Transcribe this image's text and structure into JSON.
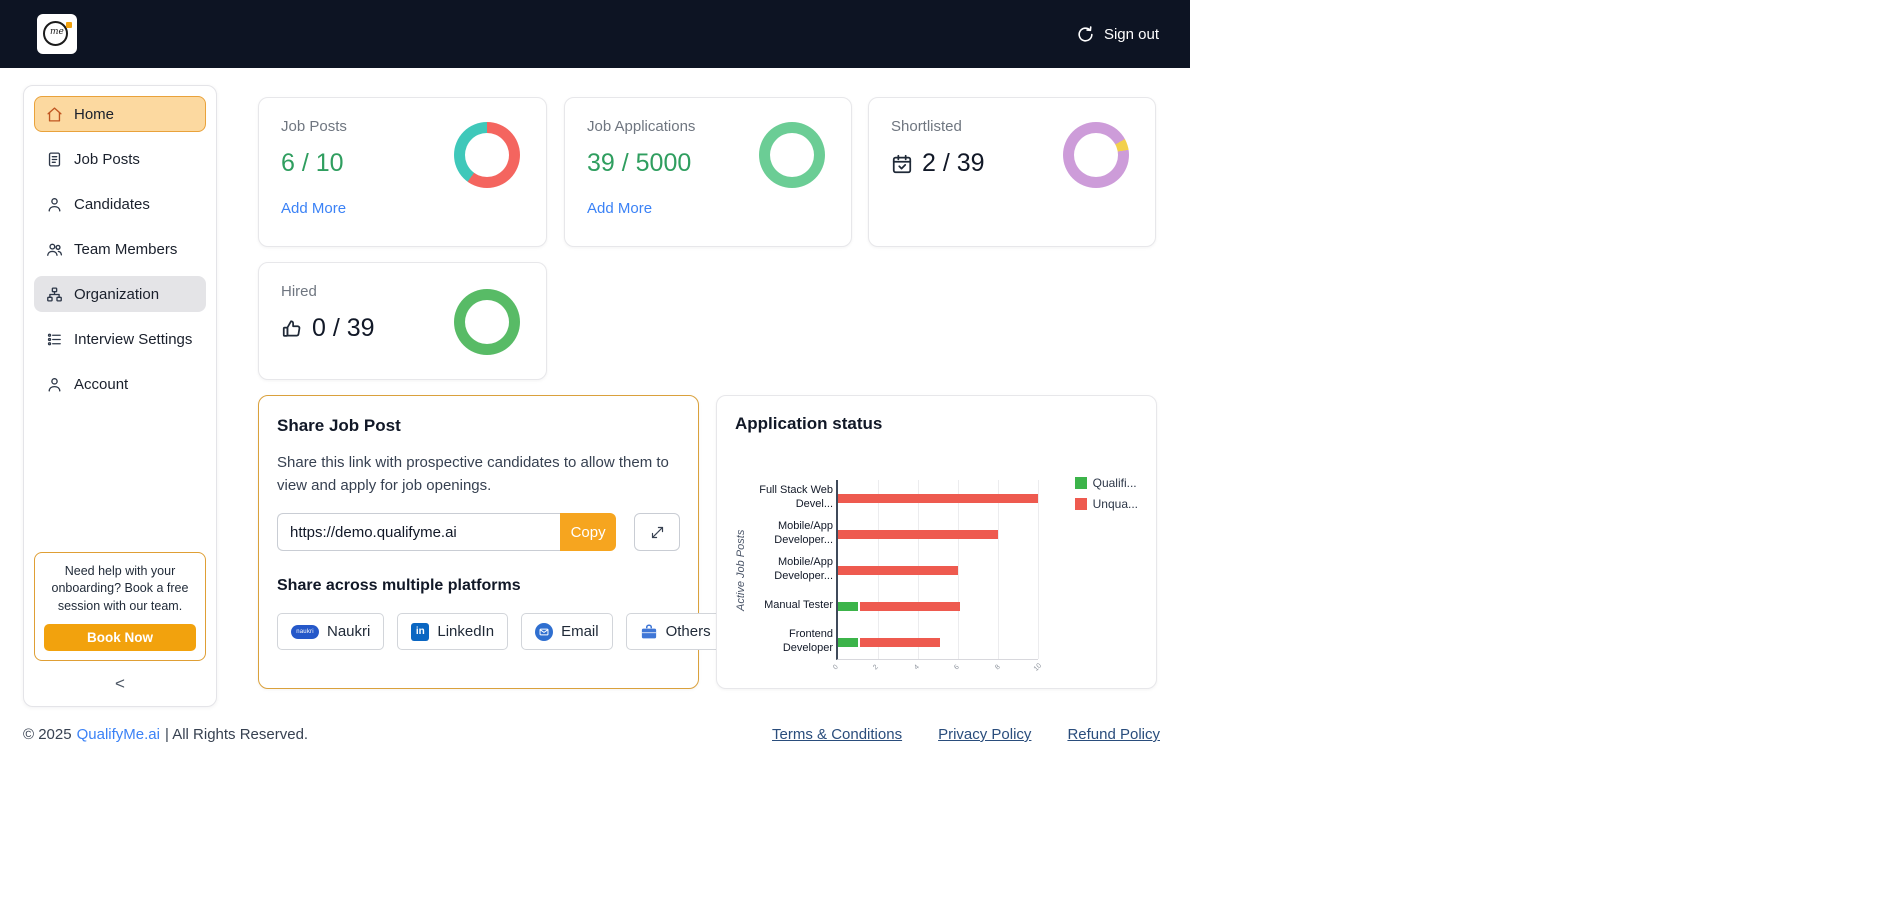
{
  "colors": {
    "header_bg": "#0d1423",
    "accent_orange": "#f2a20d",
    "link_blue": "#3b82f6",
    "value_green": "#2f9e5f",
    "active_nav_bg": "#fcd9a0",
    "active_nav_border": "#e9a23b"
  },
  "header": {
    "logo_me": "me",
    "sign_out_label": "Sign out"
  },
  "sidebar": {
    "items": [
      {
        "label": "Home"
      },
      {
        "label": "Job Posts"
      },
      {
        "label": "Candidates"
      },
      {
        "label": "Team Members"
      },
      {
        "label": "Organization"
      },
      {
        "label": "Interview Settings"
      },
      {
        "label": "Account"
      }
    ],
    "help_text": "Need help with your onboarding? Book a free session with our team.",
    "book_now_label": "Book Now",
    "collapse_label": "<"
  },
  "stats": [
    {
      "title": "Job Posts",
      "value": "6 / 10",
      "link_label": "Add More",
      "donut": {
        "segments": [
          {
            "name": "used",
            "color": "#f4655f",
            "pct": 60
          },
          {
            "name": "remaining",
            "color": "#3fc8ba",
            "pct": 40
          }
        ]
      }
    },
    {
      "title": "Job Applications",
      "value": "39 / 5000",
      "link_label": "Add More",
      "donut": {
        "segments": [
          {
            "name": "remaining",
            "color": "#6bcd95",
            "pct": 100
          }
        ]
      }
    },
    {
      "title": "Shortlisted",
      "value": "2 / 39",
      "donut": {
        "segments": [
          {
            "name": "remaining",
            "color": "#cd9cd9",
            "pct": 17
          },
          {
            "name": "shortlisted",
            "color": "#f2d04c",
            "pct": 5.5
          },
          {
            "name": "remaining",
            "color": "#cd9cd9",
            "pct": 77.5
          }
        ]
      }
    },
    {
      "title": "Hired",
      "value": "0 / 39",
      "donut": {
        "segments": [
          {
            "name": "remaining",
            "color": "#58bb66",
            "pct": 100
          }
        ]
      }
    }
  ],
  "share": {
    "title": "Share Job Post",
    "description": "Share this link with prospective candidates to allow them to view and apply for job openings.",
    "url": "https://demo.qualifyme.ai",
    "copy_label": "Copy",
    "platforms_title": "Share across multiple platforms",
    "platforms": [
      {
        "label": "Naukri",
        "icon_text": "naukri"
      },
      {
        "label": "LinkedIn",
        "icon_text": "in"
      },
      {
        "label": "Email",
        "icon_text": ""
      },
      {
        "label": "Others",
        "icon_text": ""
      }
    ]
  },
  "status_panel": {
    "title": "Application status"
  },
  "chart_data": {
    "type": "bar",
    "orientation": "horizontal",
    "stacked": true,
    "title": "Application status",
    "categories": [
      "Full Stack Web\nDevel...",
      "Mobile/App\nDeveloper...",
      "Mobile/App\nDeveloper...",
      "Manual Tester",
      "Frontend\nDeveloper"
    ],
    "series": [
      {
        "name": "Qualifi...",
        "color": "#3cb44a",
        "values": [
          0,
          0,
          0,
          1,
          1
        ]
      },
      {
        "name": "Unqua...",
        "color": "#ee5a4f",
        "values": [
          10,
          8,
          6,
          5,
          4
        ]
      }
    ],
    "ylabel": "Active Job Posts",
    "xlabel": "",
    "xlim": [
      0,
      10
    ],
    "xticks": [
      0,
      2,
      4,
      6,
      8,
      10
    ],
    "grid": true,
    "legend_position": "top-right"
  },
  "footer": {
    "copyright": "© 2025",
    "brand": "QualifyMe.ai",
    "rights": "| All Rights Reserved.",
    "links": [
      {
        "label": "Terms & Conditions"
      },
      {
        "label": "Privacy Policy"
      },
      {
        "label": "Refund Policy"
      }
    ]
  }
}
